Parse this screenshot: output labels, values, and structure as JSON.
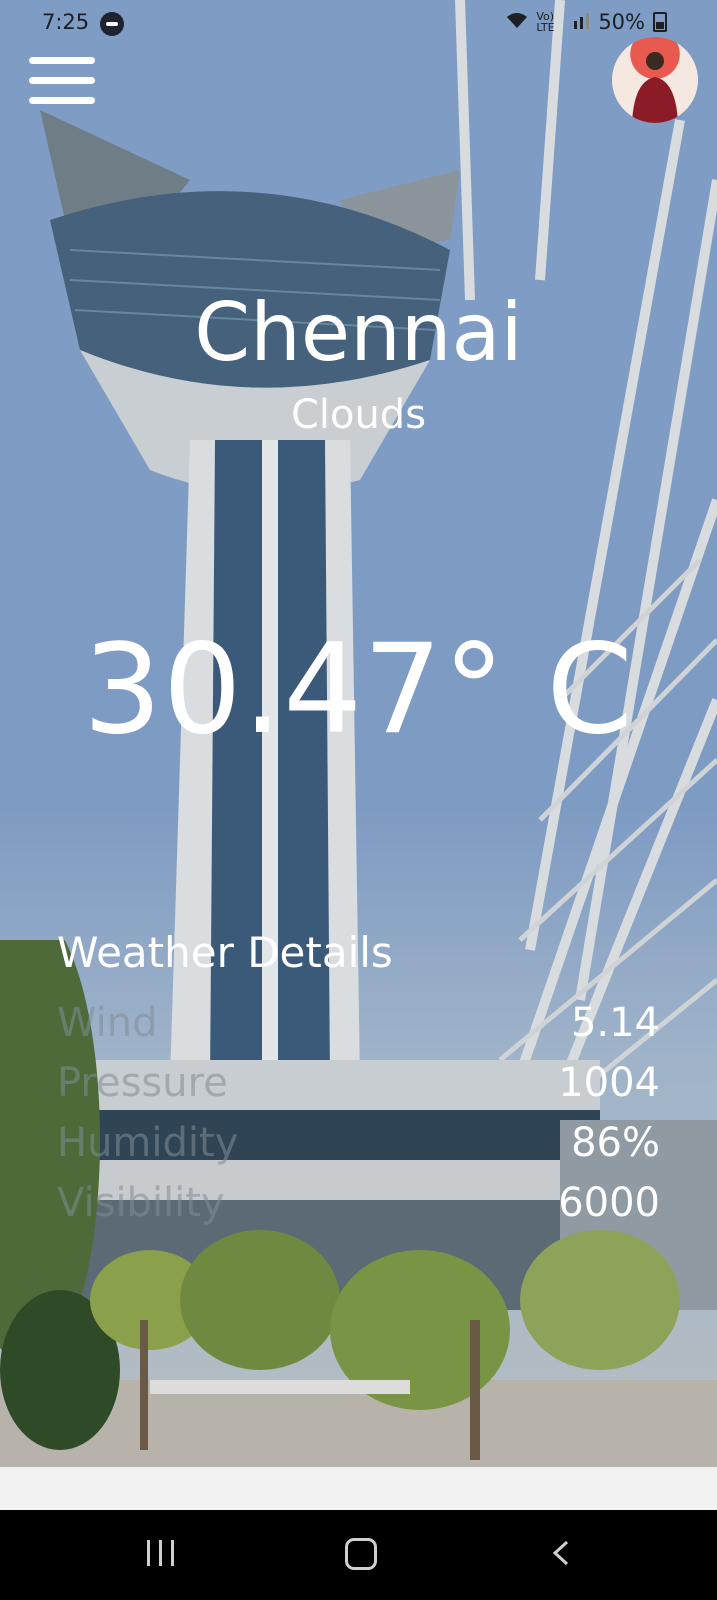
{
  "status": {
    "time": "7:25",
    "network": "Vo) LTE",
    "battery": "50%"
  },
  "weather": {
    "city": "Chennai",
    "condition": "Clouds",
    "temperature": "30.47° C",
    "details_title": "Weather Details",
    "details": [
      {
        "label": "Wind",
        "value": "5.14"
      },
      {
        "label": "Pressure",
        "value": "1004"
      },
      {
        "label": "Humidity",
        "value": "86%"
      },
      {
        "label": "Visibility",
        "value": "6000"
      }
    ]
  },
  "icons": {
    "menu": "hamburger-menu-icon",
    "avatar": "user-avatar",
    "nav_recent": "recent-apps-icon",
    "nav_home": "home-icon",
    "nav_back": "back-icon"
  },
  "colors": {
    "text": "#ffffff",
    "label": "#8c96a0",
    "sky": "#7f9cc4",
    "navbar": "#000000"
  }
}
